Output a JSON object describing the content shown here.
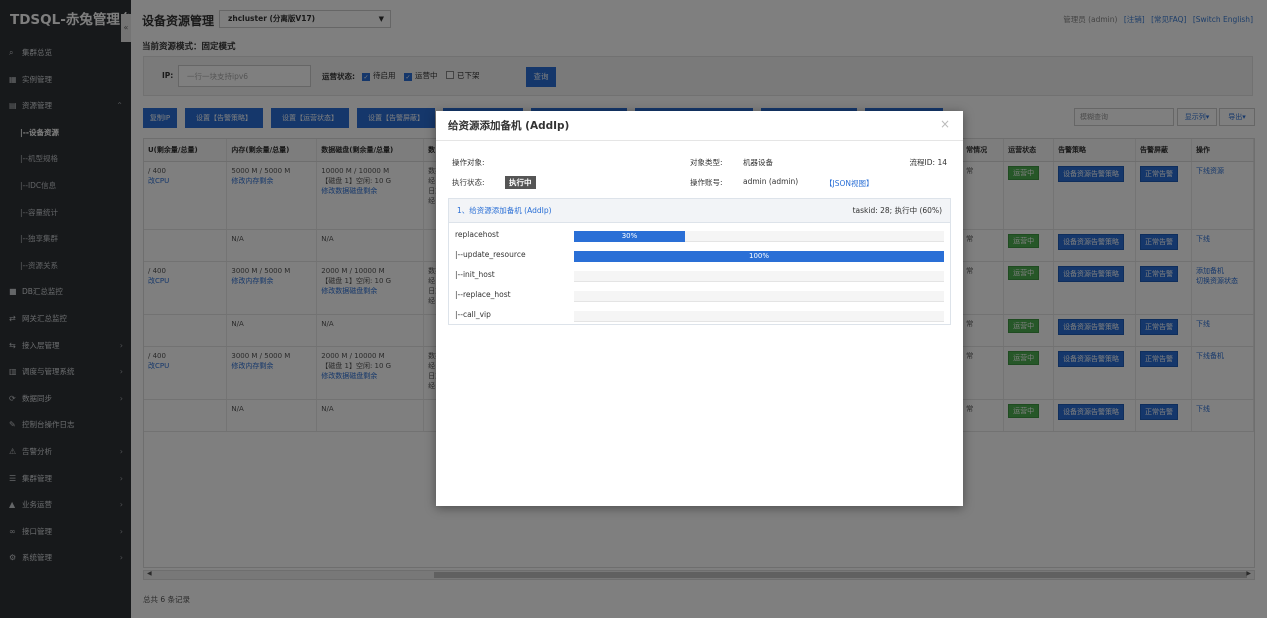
{
  "app": {
    "brand": "TDSQL-赤兔管理台"
  },
  "sidebar": {
    "items": [
      {
        "label": "集群总览",
        "icon": "search-icon"
      },
      {
        "label": "实例管理",
        "icon": "grid-icon"
      },
      {
        "label": "资源管理",
        "icon": "server-icon"
      },
      {
        "label": "|--设备资源"
      },
      {
        "label": "|--机型规格"
      },
      {
        "label": "|--IDC信息"
      },
      {
        "label": "|--容量统计"
      },
      {
        "label": "|--独享集群"
      },
      {
        "label": "|--资源关系"
      },
      {
        "label": "DB汇总监控",
        "icon": "monitor-icon"
      },
      {
        "label": "网关汇总监控",
        "icon": "shuffle-icon"
      },
      {
        "label": "接入层管理",
        "icon": "swap-icon"
      },
      {
        "label": "调度与管理系统",
        "icon": "blocks-icon"
      },
      {
        "label": "数据同步",
        "icon": "sync-icon"
      },
      {
        "label": "控制台操作日志",
        "icon": "wrench-icon"
      },
      {
        "label": "告警分析",
        "icon": "warning-icon"
      },
      {
        "label": "集群管理",
        "icon": "list-icon"
      },
      {
        "label": "业务运营",
        "icon": "chart-icon"
      },
      {
        "label": "接口管理",
        "icon": "link-icon"
      },
      {
        "label": "系统管理",
        "icon": "gear-icon"
      }
    ]
  },
  "header": {
    "title": "设备资源管理",
    "cluster_select": "zhcluster (分离版V17)",
    "user_text": "管理员 (admin)",
    "links": [
      "[注销]",
      "[常见FAQ]",
      "[Switch English]"
    ],
    "mode_text": "当前资源模式：固定模式"
  },
  "filter": {
    "ip_label": "IP:",
    "ip_placeholder": "一行一块支持ipv6",
    "status_label": "运营状态:",
    "checks": [
      {
        "label": "待启用",
        "checked": true
      },
      {
        "label": "运营中",
        "checked": true
      },
      {
        "label": "已下架",
        "checked": false
      }
    ],
    "query_btn": "查询"
  },
  "actions": {
    "buttons": [
      "复制IP",
      "设置【告警策略】",
      "设置【运营状态】",
      "设置【告警屏蔽】"
    ],
    "search_placeholder": "模糊查询",
    "columns_btn": "显示列▾",
    "export_btn": "导出▾"
  },
  "table": {
    "headers": [
      "U(剩余量/总量)",
      "内存(剩余量/总量)",
      "数据磁盘(剩余量/总量)",
      "数",
      "常情况",
      "运营状态",
      "告警策略",
      "告警屏蔽",
      "操作"
    ],
    "rows": [
      {
        "cpu": "/ 400",
        "cpu_link": "改CPU",
        "mem": "5000 M / 5000 M",
        "mem_link": "修改内存剩余",
        "disk": "10000 M / 10000 M",
        "disk2": "【磁盘 1】空闲: 10 G",
        "disk_link": "修改数据磁盘剩余",
        "misc": [
          "数据",
          "经:",
          "日志",
          "经:"
        ],
        "health": "常",
        "status": "运营中",
        "policy": "设备资源告警策略",
        "shield": "正常告警",
        "ops": [
          "下线资源"
        ]
      },
      {
        "cpu": "",
        "cpu_link": "",
        "mem": "N/A",
        "mem_link": "",
        "disk": "N/A",
        "disk2": "",
        "disk_link": "",
        "misc": [],
        "health": "常",
        "status": "运营中",
        "policy": "设备资源告警策略",
        "shield": "正常告警",
        "ops": [
          "下线"
        ]
      },
      {
        "cpu": "/ 400",
        "cpu_link": "改CPU",
        "mem": "3000 M / 5000 M",
        "mem_link": "修改内存剩余",
        "disk": "2000 M / 10000 M",
        "disk2": "【磁盘 1】空闲: 10 G",
        "disk_link": "修改数据磁盘剩余",
        "misc": [
          "数据",
          "经:",
          "日志",
          "经:"
        ],
        "health": "常",
        "status": "运营中",
        "policy": "设备资源告警策略",
        "shield": "正常告警",
        "ops": [
          "添加备机",
          "切换资源状态"
        ]
      },
      {
        "cpu": "",
        "cpu_link": "",
        "mem": "N/A",
        "mem_link": "",
        "disk": "N/A",
        "disk2": "",
        "disk_link": "",
        "misc": [],
        "health": "常",
        "status": "运营中",
        "policy": "设备资源告警策略",
        "shield": "正常告警",
        "ops": [
          "下线"
        ]
      },
      {
        "cpu": "/ 400",
        "cpu_link": "改CPU",
        "mem": "3000 M / 5000 M",
        "mem_link": "修改内存剩余",
        "disk": "2000 M / 10000 M",
        "disk2": "【磁盘 1】空闲: 10 G",
        "disk_link": "修改数据磁盘剩余",
        "misc": [
          "数据",
          "经:",
          "日志",
          "经:"
        ],
        "health": "常",
        "status": "运营中",
        "policy": "设备资源告警策略",
        "shield": "正常告警",
        "ops": [
          "下线备机"
        ]
      },
      {
        "cpu": "",
        "cpu_link": "",
        "mem": "N/A",
        "mem_link": "",
        "disk": "N/A",
        "disk2": "",
        "disk_link": "",
        "misc": [],
        "health": "常",
        "status": "运营中",
        "policy": "设备资源告警策略",
        "shield": "正常告警",
        "ops": [
          "下线"
        ]
      }
    ]
  },
  "footer": {
    "total": "总共 6 条记录"
  },
  "modal": {
    "title": "给资源添加备机 (AddIp)",
    "target_label": "操作对象:",
    "type_label": "对象类型:",
    "type_value": "机器设备",
    "flow_id": "流程ID: 14",
    "state_label": "执行状态:",
    "state_value": "执行中",
    "account_label": "操作账号:",
    "account_value": "admin (admin)",
    "json_link": "【JSON视图】",
    "task": {
      "title": "1、给资源添加备机 (AddIp)",
      "status": "taskid: 28; 执行中 (60%)",
      "steps": [
        {
          "name": "replacehost",
          "progress": 30,
          "label": "30%"
        },
        {
          "name": "|--update_resource",
          "progress": 100,
          "label": "100%"
        },
        {
          "name": "|--init_host",
          "progress": 0,
          "label": ""
        },
        {
          "name": "|--replace_host",
          "progress": 0,
          "label": ""
        },
        {
          "name": "|--call_vip",
          "progress": 0,
          "label": ""
        }
      ]
    }
  },
  "colors": {
    "accent": "#2a6fd6",
    "sidebar_bg": "#2f3236",
    "success": "#4caf50"
  }
}
